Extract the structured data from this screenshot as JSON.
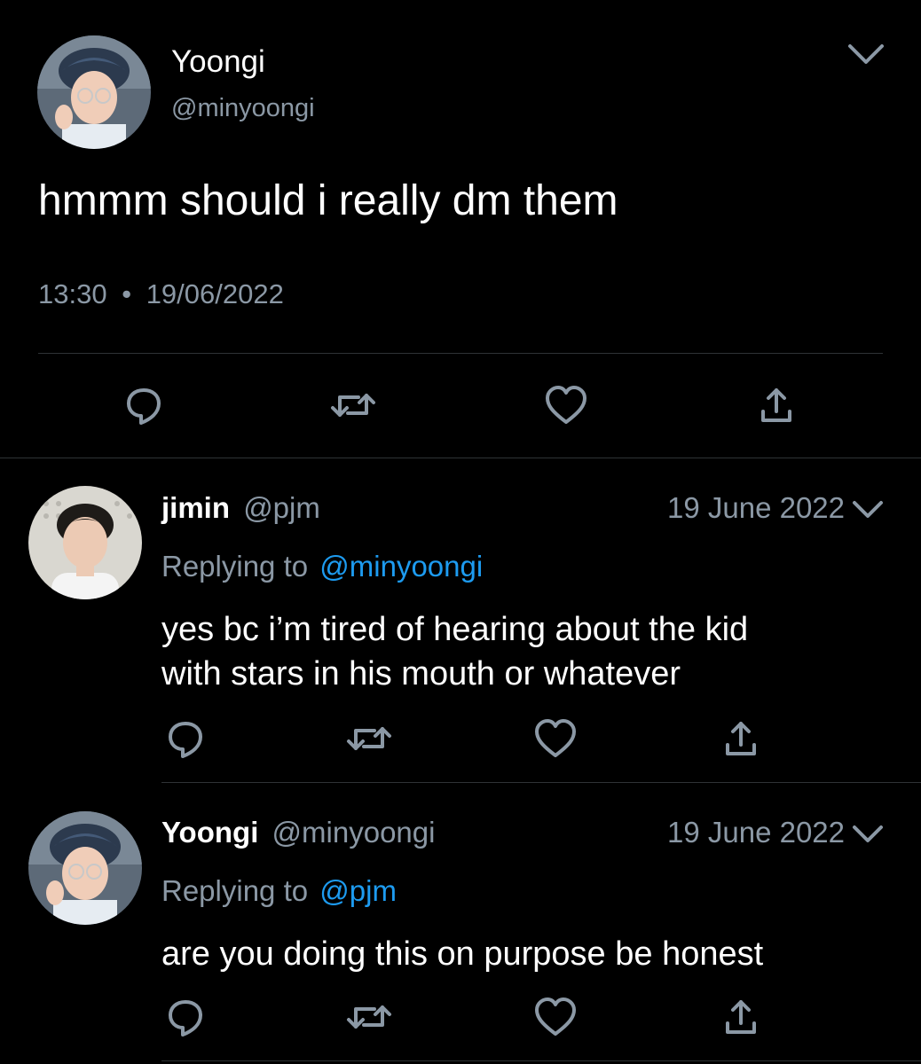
{
  "main_tweet": {
    "name": "Yoongi",
    "handle": "@minyoongi",
    "text": "hmmm should i really dm them",
    "time": "13:30",
    "separator": "•",
    "date": "19/06/2022",
    "avatar_icon": "avatar-yoongi"
  },
  "replies": [
    {
      "name": "jimin",
      "handle": "@pjm",
      "date": "19 June 2022",
      "replying_prefix": "Replying to",
      "replying_handle": "@minyoongi",
      "text_line1": "yes bc i’m tired of hearing about the kid",
      "text_line2": "with stars in his mouth or whatever",
      "avatar_icon": "avatar-jimin"
    },
    {
      "name": "Yoongi",
      "handle": "@minyoongi",
      "date": "19 June 2022",
      "replying_prefix": "Replying to",
      "replying_handle": "@pjm",
      "text_line1": "are you doing this on purpose be honest",
      "avatar_icon": "avatar-yoongi"
    }
  ],
  "actions": [
    "reply-icon",
    "retweet-icon",
    "like-icon",
    "share-icon"
  ],
  "colors": {
    "background": "#000000",
    "text": "#ffffff",
    "muted": "#8b98a5",
    "link": "#1d9bf0",
    "divider": "#2f3336"
  }
}
